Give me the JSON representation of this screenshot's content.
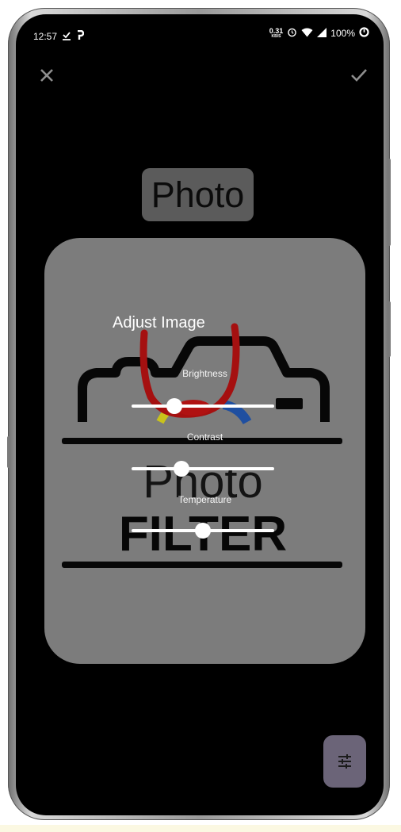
{
  "status_bar": {
    "time": "12:57",
    "net_speed": "0.31",
    "net_unit": "KB/S",
    "battery": "100%"
  },
  "title_chip": {
    "text": "Photo"
  },
  "adjust": {
    "title": "Adjust Image",
    "sliders": [
      {
        "label": "Brightness",
        "value": 0.3
      },
      {
        "label": "Contrast",
        "value": 0.35
      },
      {
        "label": "Temperature",
        "value": 0.5
      }
    ]
  },
  "logo": {
    "line1": "Photo",
    "line2": "FILTER"
  },
  "icons": {
    "close": "close-icon",
    "confirm": "check-icon",
    "adjust": "tune-icon"
  },
  "colors": {
    "scrim": "#000000",
    "card": "#7c7c7c",
    "drawing": "#b01212",
    "fab": "#6b6478"
  }
}
